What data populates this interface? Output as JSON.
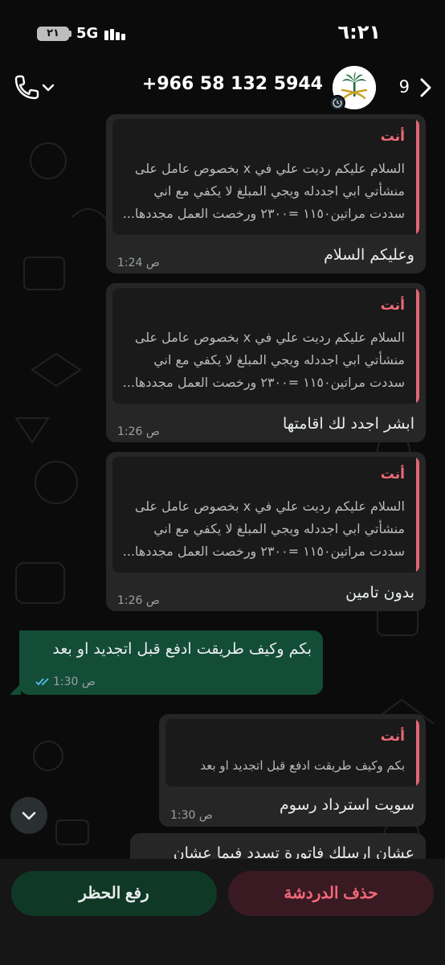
{
  "status_bar": {
    "battery": "٢١",
    "network": "5G",
    "time": "٦:٢١"
  },
  "header": {
    "contact": "+966 58 132 5944",
    "back_count": "9"
  },
  "messages": [
    {
      "quote_author": "أنت",
      "quote_text": "السلام عليكم رديت علي في x بخصوص عامل على منشأتي ابي اجددله ويجي المبلغ لا يكفي مع اني سددت مراتين١١٥٠ =٢٣٠٠ ورخصت العمل مجددها...",
      "text": "وعليكم السلام",
      "time": "1:24 ص"
    },
    {
      "quote_author": "أنت",
      "quote_text": "السلام عليكم رديت علي في x بخصوص عامل على منشأتي ابي اجددله ويجي المبلغ لا يكفي مع اني سددت مراتين١١٥٠ =٢٣٠٠ ورخصت العمل مجددها...",
      "text": "ابشر اجدد لك اقامتها",
      "time": "1:26 ص"
    },
    {
      "quote_author": "أنت",
      "quote_text": "السلام عليكم رديت علي في x بخصوص عامل على منشأتي ابي اجددله ويجي المبلغ لا يكفي مع اني سددت مراتين١١٥٠ =٢٣٠٠ ورخصت العمل مجددها...",
      "text": "بدون تامين",
      "time": "1:26 ص"
    },
    {
      "text": "بكم وكيف طريقت ادفع قبل اتجديد او بعد",
      "time": "1:30 ص"
    },
    {
      "quote_author": "أنت",
      "quote_text": "بكم وكيف طريقت ادفع قبل اتجديد او بعد",
      "text": "سويت استرداد رسوم",
      "time": "1:30 ص"
    },
    {
      "text": "عشان ارسلك فاتورة تسدد فيما عشان"
    }
  ],
  "actions": {
    "delete_chat": "حذف الدردشة",
    "unblock": "رفع الحظر"
  },
  "colors": {
    "incoming_bubble": "#262626",
    "outgoing_bubble": "#134d37",
    "quote_accent": "#e26673",
    "read_ticks": "#53bdeb"
  }
}
